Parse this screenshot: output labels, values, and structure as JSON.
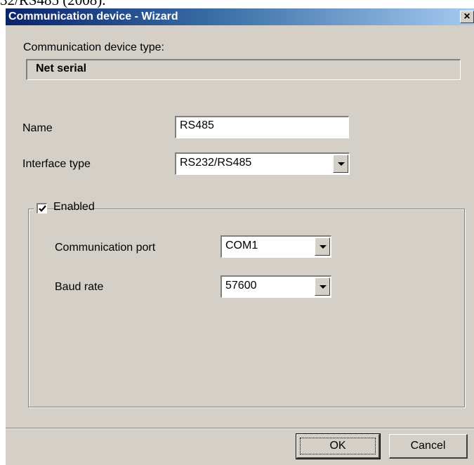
{
  "above_text": "32/RS485 (2008).",
  "window": {
    "title": "Communication device - Wizard",
    "close_glyph": "×"
  },
  "device_type": {
    "label": "Communication device type:",
    "value": "Net serial"
  },
  "form": {
    "name_label": "Name",
    "name_value": "RS485",
    "interface_label": "Interface type",
    "interface_value": "RS232/RS485"
  },
  "group": {
    "enabled_label": "Enabled",
    "enabled_checked": true,
    "port_label": "Communication port",
    "port_value": "COM1",
    "baud_label": "Baud rate",
    "baud_value": "57600"
  },
  "buttons": {
    "ok": "OK",
    "cancel": "Cancel"
  },
  "icons": {
    "close": "close-icon",
    "dropdown": "chevron-down-icon",
    "check": "checkmark-icon"
  }
}
